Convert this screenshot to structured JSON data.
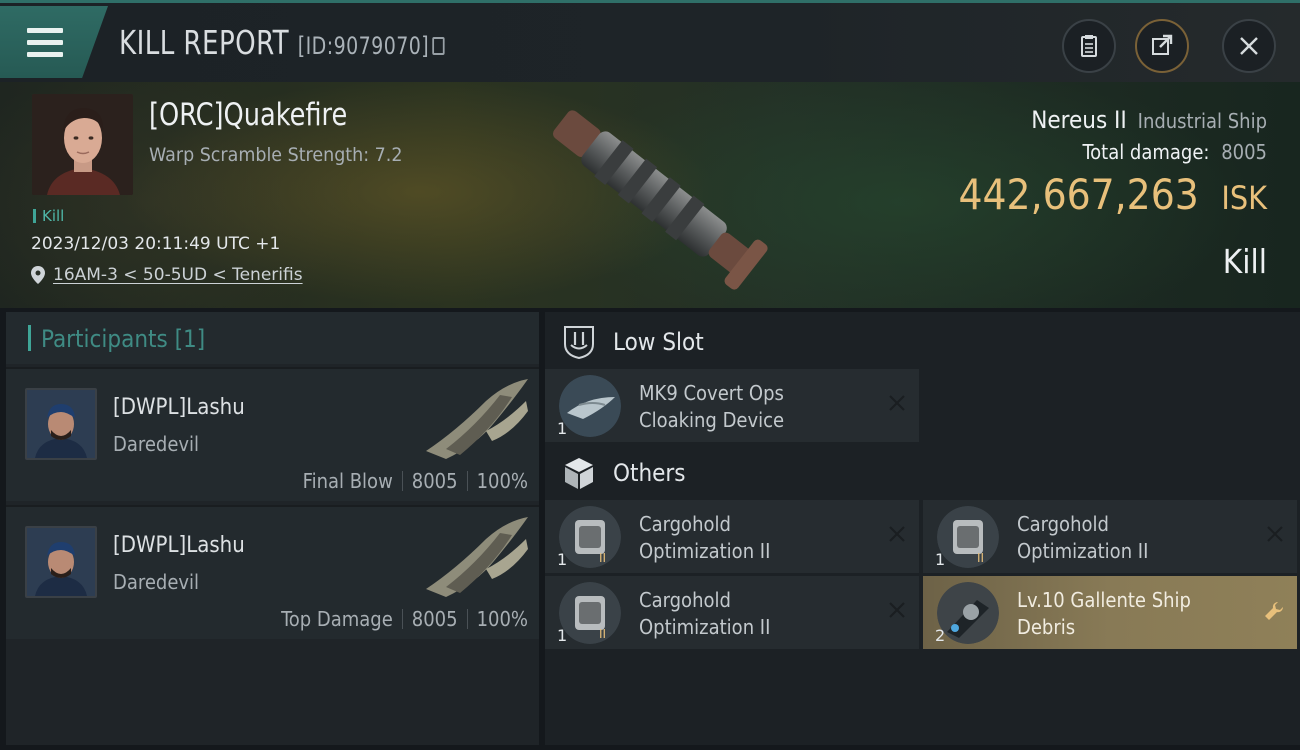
{
  "header": {
    "title": "KILL REPORT",
    "report_id": "[ID:9079070]"
  },
  "victim": {
    "name": "[ORC]Quakefire",
    "warp_scramble": "Warp Scramble Strength: 7.2",
    "kill_tag": "Kill",
    "datetime": "2023/12/03 20:11:49 UTC +1",
    "location": "16AM-3 < 50-5UD < Tenerifis",
    "ship_name": "Nereus II",
    "ship_class": "Industrial Ship",
    "total_damage_label": "Total damage:",
    "total_damage": "8005",
    "isk_value": "442,667,263",
    "isk_unit": "ISK",
    "result": "Kill"
  },
  "participants": {
    "header": "Participants [1]",
    "rows": [
      {
        "name": "[DWPL]Lashu",
        "ship": "Daredevil",
        "role": "Final Blow",
        "damage": "8005",
        "percent": "100%"
      },
      {
        "name": "[DWPL]Lashu",
        "ship": "Daredevil",
        "role": "Top Damage",
        "damage": "8005",
        "percent": "100%"
      }
    ]
  },
  "fitting": {
    "low_slot": {
      "label": "Low Slot",
      "items": [
        {
          "line1": "MK9 Covert Ops",
          "line2": "Cloaking Device",
          "qty": "1"
        }
      ]
    },
    "others": {
      "label": "Others",
      "items": [
        {
          "line1": "Cargohold",
          "line2": "Optimization II",
          "qty": "1"
        },
        {
          "line1": "Cargohold",
          "line2": "Optimization II",
          "qty": "1"
        },
        {
          "line1": "Cargohold",
          "line2": "Optimization II",
          "qty": "1"
        },
        {
          "line1": "Lv.10 Gallente Ship",
          "line2": "Debris",
          "qty": "2"
        }
      ]
    }
  },
  "icons": {
    "menu": "menu-icon",
    "copy": "copy-icon",
    "clipboard": "clipboard-icon",
    "share": "share-icon",
    "close": "close-icon",
    "location": "location-pin-icon",
    "low_slot": "low-slot-icon",
    "others": "cube-icon",
    "destroyed": "x-icon",
    "salvage": "wrench-icon"
  },
  "colors": {
    "accent_teal": "#2f6b64",
    "isk_gold": "#e8c07b",
    "kill_teal": "#4fb7a8",
    "highlight_item": "#887a56"
  }
}
